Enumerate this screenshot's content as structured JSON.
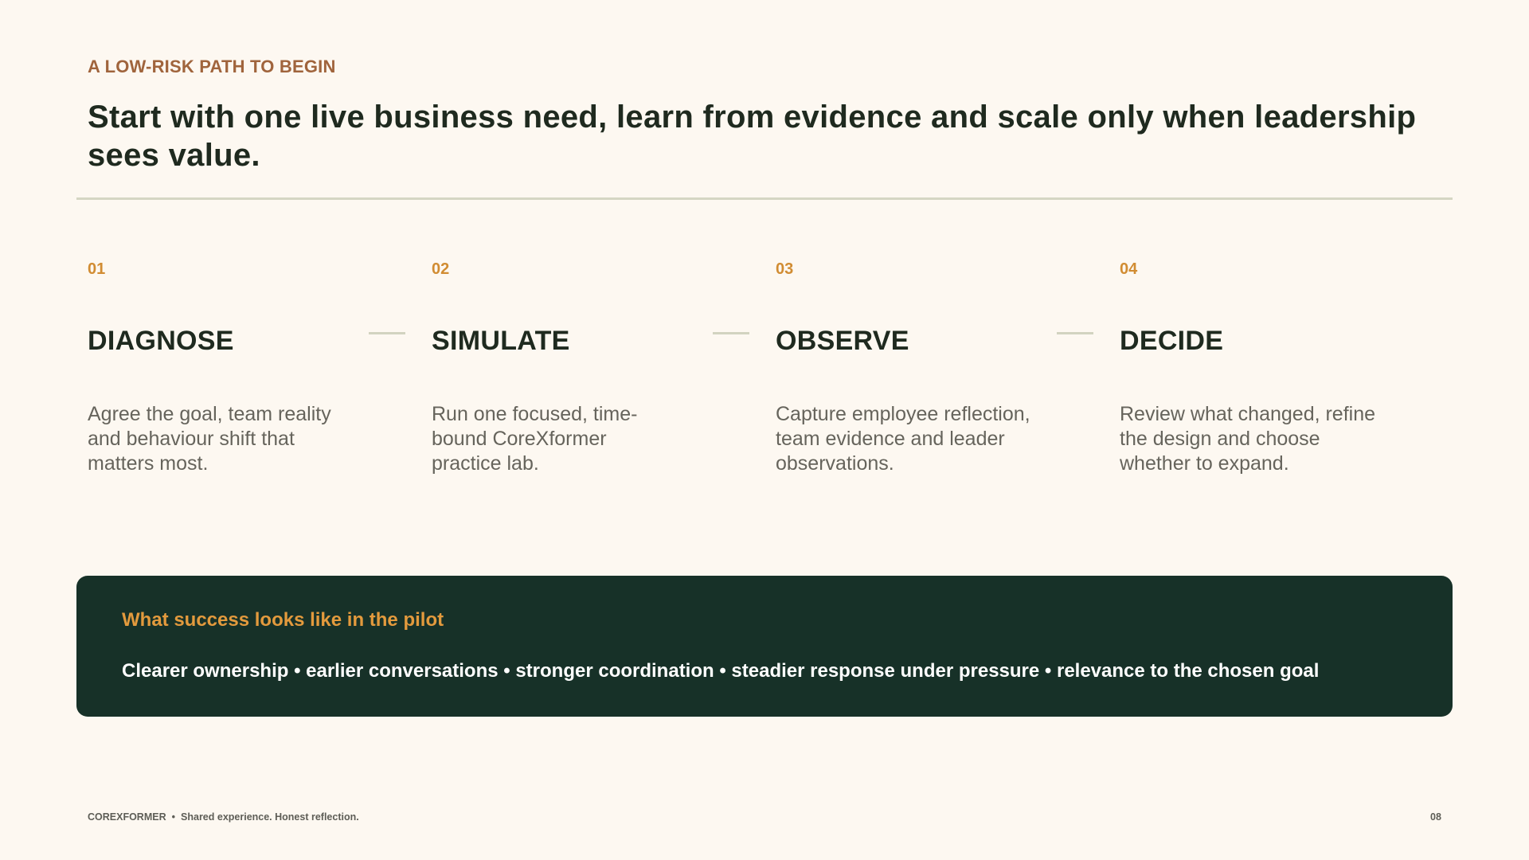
{
  "eyebrow": "A LOW-RISK PATH TO BEGIN",
  "headline": "Start with one live business need, learn from evidence and scale only when leadership sees value.",
  "steps": [
    {
      "number": "01",
      "title": "DIAGNOSE",
      "description": "Agree the goal, team reality and behaviour shift that matters most."
    },
    {
      "number": "02",
      "title": "SIMULATE",
      "description": "Run one focused, time-bound CoreXformer practice lab."
    },
    {
      "number": "03",
      "title": "OBSERVE",
      "description": "Capture employee reflection, team evidence and leader observations."
    },
    {
      "number": "04",
      "title": "DECIDE",
      "description": "Review what changed, refine the design and choose whether to expand."
    }
  ],
  "success": {
    "title": "What success looks like in the pilot",
    "outcomes": "Clearer ownership • earlier conversations • stronger coordination • steadier response under pressure • relevance to the chosen goal"
  },
  "footer": {
    "brand": "COREXFORMER",
    "separator": "•",
    "tagline": "Shared experience. Honest reflection.",
    "page_number": "08"
  },
  "colors": {
    "background": "#fdf8f1",
    "eyebrow": "#a0643c",
    "accent": "#d18c32",
    "panel": "#173128",
    "text": "#1f2a1f",
    "muted": "#66645c"
  }
}
